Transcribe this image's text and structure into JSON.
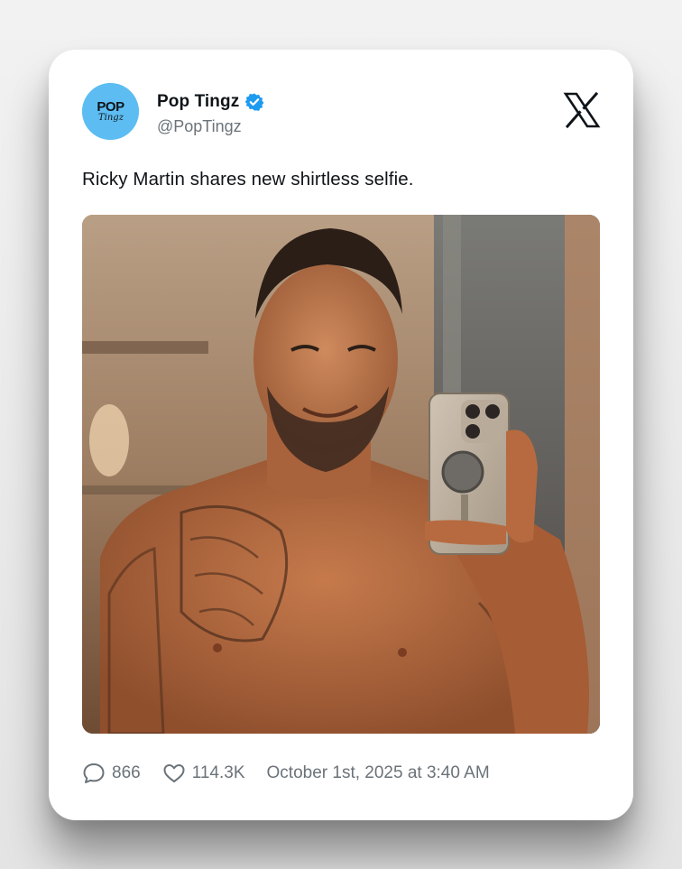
{
  "tweet": {
    "author": {
      "display_name": "Pop Tingz",
      "handle": "@PopTingz",
      "verified": true,
      "avatar_text_top": "POP",
      "avatar_text_bottom": "Tingz",
      "avatar_color": "#5dbdf2"
    },
    "text": "Ricky Martin shares new shirtless selfie.",
    "media": {
      "description_icon": "photo"
    },
    "stats": {
      "replies": "866",
      "likes": "114.3K"
    },
    "timestamp": "October 1st, 2025 at 3:40 AM"
  },
  "icons": {
    "verified": "verified-badge-icon",
    "platform": "x-logo-icon",
    "reply": "comment-bubble-icon",
    "like": "heart-icon"
  },
  "colors": {
    "verified": "#1d9bf0",
    "muted_text": "#6b7379",
    "primary_text": "#0f1419"
  }
}
